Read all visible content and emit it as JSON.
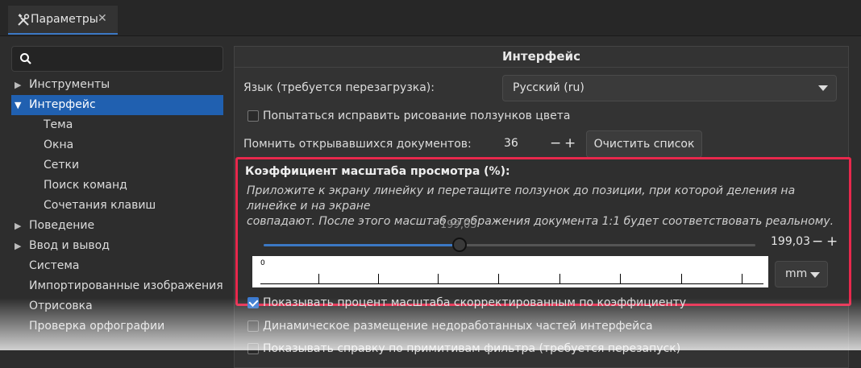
{
  "tab": {
    "icon": "tools-icon",
    "label": "Параметры",
    "close": "✕"
  },
  "search": {
    "icon": "search-icon",
    "placeholder": ""
  },
  "sidebar": {
    "items": [
      {
        "label": "Инструменты",
        "expander": "collapsed"
      },
      {
        "label": "Интерфейс",
        "expander": "expanded",
        "selected": true
      },
      {
        "label": "Тема"
      },
      {
        "label": "Окна"
      },
      {
        "label": "Сетки"
      },
      {
        "label": "Поиск команд"
      },
      {
        "label": "Сочетания клавиш"
      },
      {
        "label": "Поведение",
        "expander": "collapsed"
      },
      {
        "label": "Ввод и вывод",
        "expander": "collapsed"
      },
      {
        "label": "Система"
      },
      {
        "label": "Импортированные изображения"
      },
      {
        "label": "Отрисовка"
      },
      {
        "label": "Проверка орфографии"
      }
    ]
  },
  "main": {
    "title": "Интерфейс",
    "language_label": "Язык (требуется перезагрузка):",
    "language_value": "Русский (ru)",
    "fix_color_sliders_label": "Попытаться исправить рисование ползунков цвета",
    "fix_color_sliders_checked": false,
    "recent_docs_label": "Помнить открывавшихся документов:",
    "recent_docs_value": "36",
    "minus": "−",
    "plus": "+",
    "clear_list_label": "Очистить список",
    "scale": {
      "title": "Коэффициент масштаба просмотра (%):",
      "description_line1": "Приложите к экрану линейку и перетащите ползунок до позиции, при которой деления на линейке и на экране",
      "description_line2": "совпадают. После этого масштаб отображения документа 1:1 будет соответствовать реальному.",
      "slider_bubble": "199,03",
      "value": "199,03",
      "slider_fraction": 0.4,
      "ruler_zero": "0",
      "unit": "mm"
    },
    "show_zoom_corrected_label": "Показывать процент масштаба скорректированным по коэффициенту",
    "show_zoom_corrected_checked": true,
    "dynamic_layout_label": "Динамическое размещение недоработанных частей интерфейса",
    "dynamic_layout_checked": false,
    "filter_help_label": "Показывать справку по примитивам фильтра (требуется перезапуск)",
    "filter_help_checked": false
  },
  "colors": {
    "accent": "#3b78c4",
    "highlight_border": "#e8284c",
    "selected_row": "#2060b0"
  }
}
